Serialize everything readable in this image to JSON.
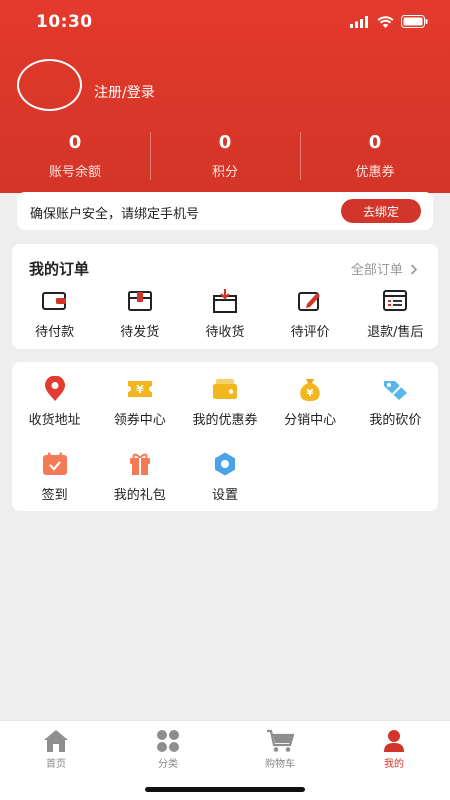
{
  "status_bar": {
    "time": "10:30"
  },
  "profile": {
    "login_label": "注册/登录"
  },
  "stats": [
    {
      "value": "0",
      "label": "账号余额"
    },
    {
      "value": "0",
      "label": "积分"
    },
    {
      "value": "0",
      "label": "优惠券"
    }
  ],
  "bind_phone": {
    "text": "确保账户安全，请绑定手机号",
    "button": "去绑定"
  },
  "orders": {
    "title": "我的订单",
    "all_label": "全部订单",
    "items": [
      {
        "label": "待付款",
        "icon": "wallet-icon"
      },
      {
        "label": "待发货",
        "icon": "package-icon"
      },
      {
        "label": "待收货",
        "icon": "receive-box-icon"
      },
      {
        "label": "待评价",
        "icon": "edit-review-icon"
      },
      {
        "label": "退款/售后",
        "icon": "refund-list-icon"
      }
    ]
  },
  "services": {
    "row1": [
      {
        "label": "收货地址",
        "icon": "location-pin-icon"
      },
      {
        "label": "领券中心",
        "icon": "coupon-ticket-icon"
      },
      {
        "label": "我的优惠券",
        "icon": "my-coupon-icon"
      },
      {
        "label": "分销中心",
        "icon": "money-bag-icon"
      },
      {
        "label": "我的砍价",
        "icon": "price-tag-icon"
      }
    ],
    "row2": [
      {
        "label": "签到",
        "icon": "calendar-checkin-icon"
      },
      {
        "label": "我的礼包",
        "icon": "gift-icon"
      },
      {
        "label": "设置",
        "icon": "settings-gear-icon"
      }
    ]
  },
  "tabbar": {
    "items": [
      {
        "label": "首页",
        "icon": "home-icon"
      },
      {
        "label": "分类",
        "icon": "category-grid-icon"
      },
      {
        "label": "购物车",
        "icon": "cart-icon"
      },
      {
        "label": "我的",
        "icon": "user-icon"
      }
    ],
    "active": "我的"
  },
  "colors": {
    "brand_red": "#d2352a",
    "header_red": "#e33a2c",
    "page_bg": "#eeeeee",
    "coupon_yellow": "#f2b71f"
  }
}
